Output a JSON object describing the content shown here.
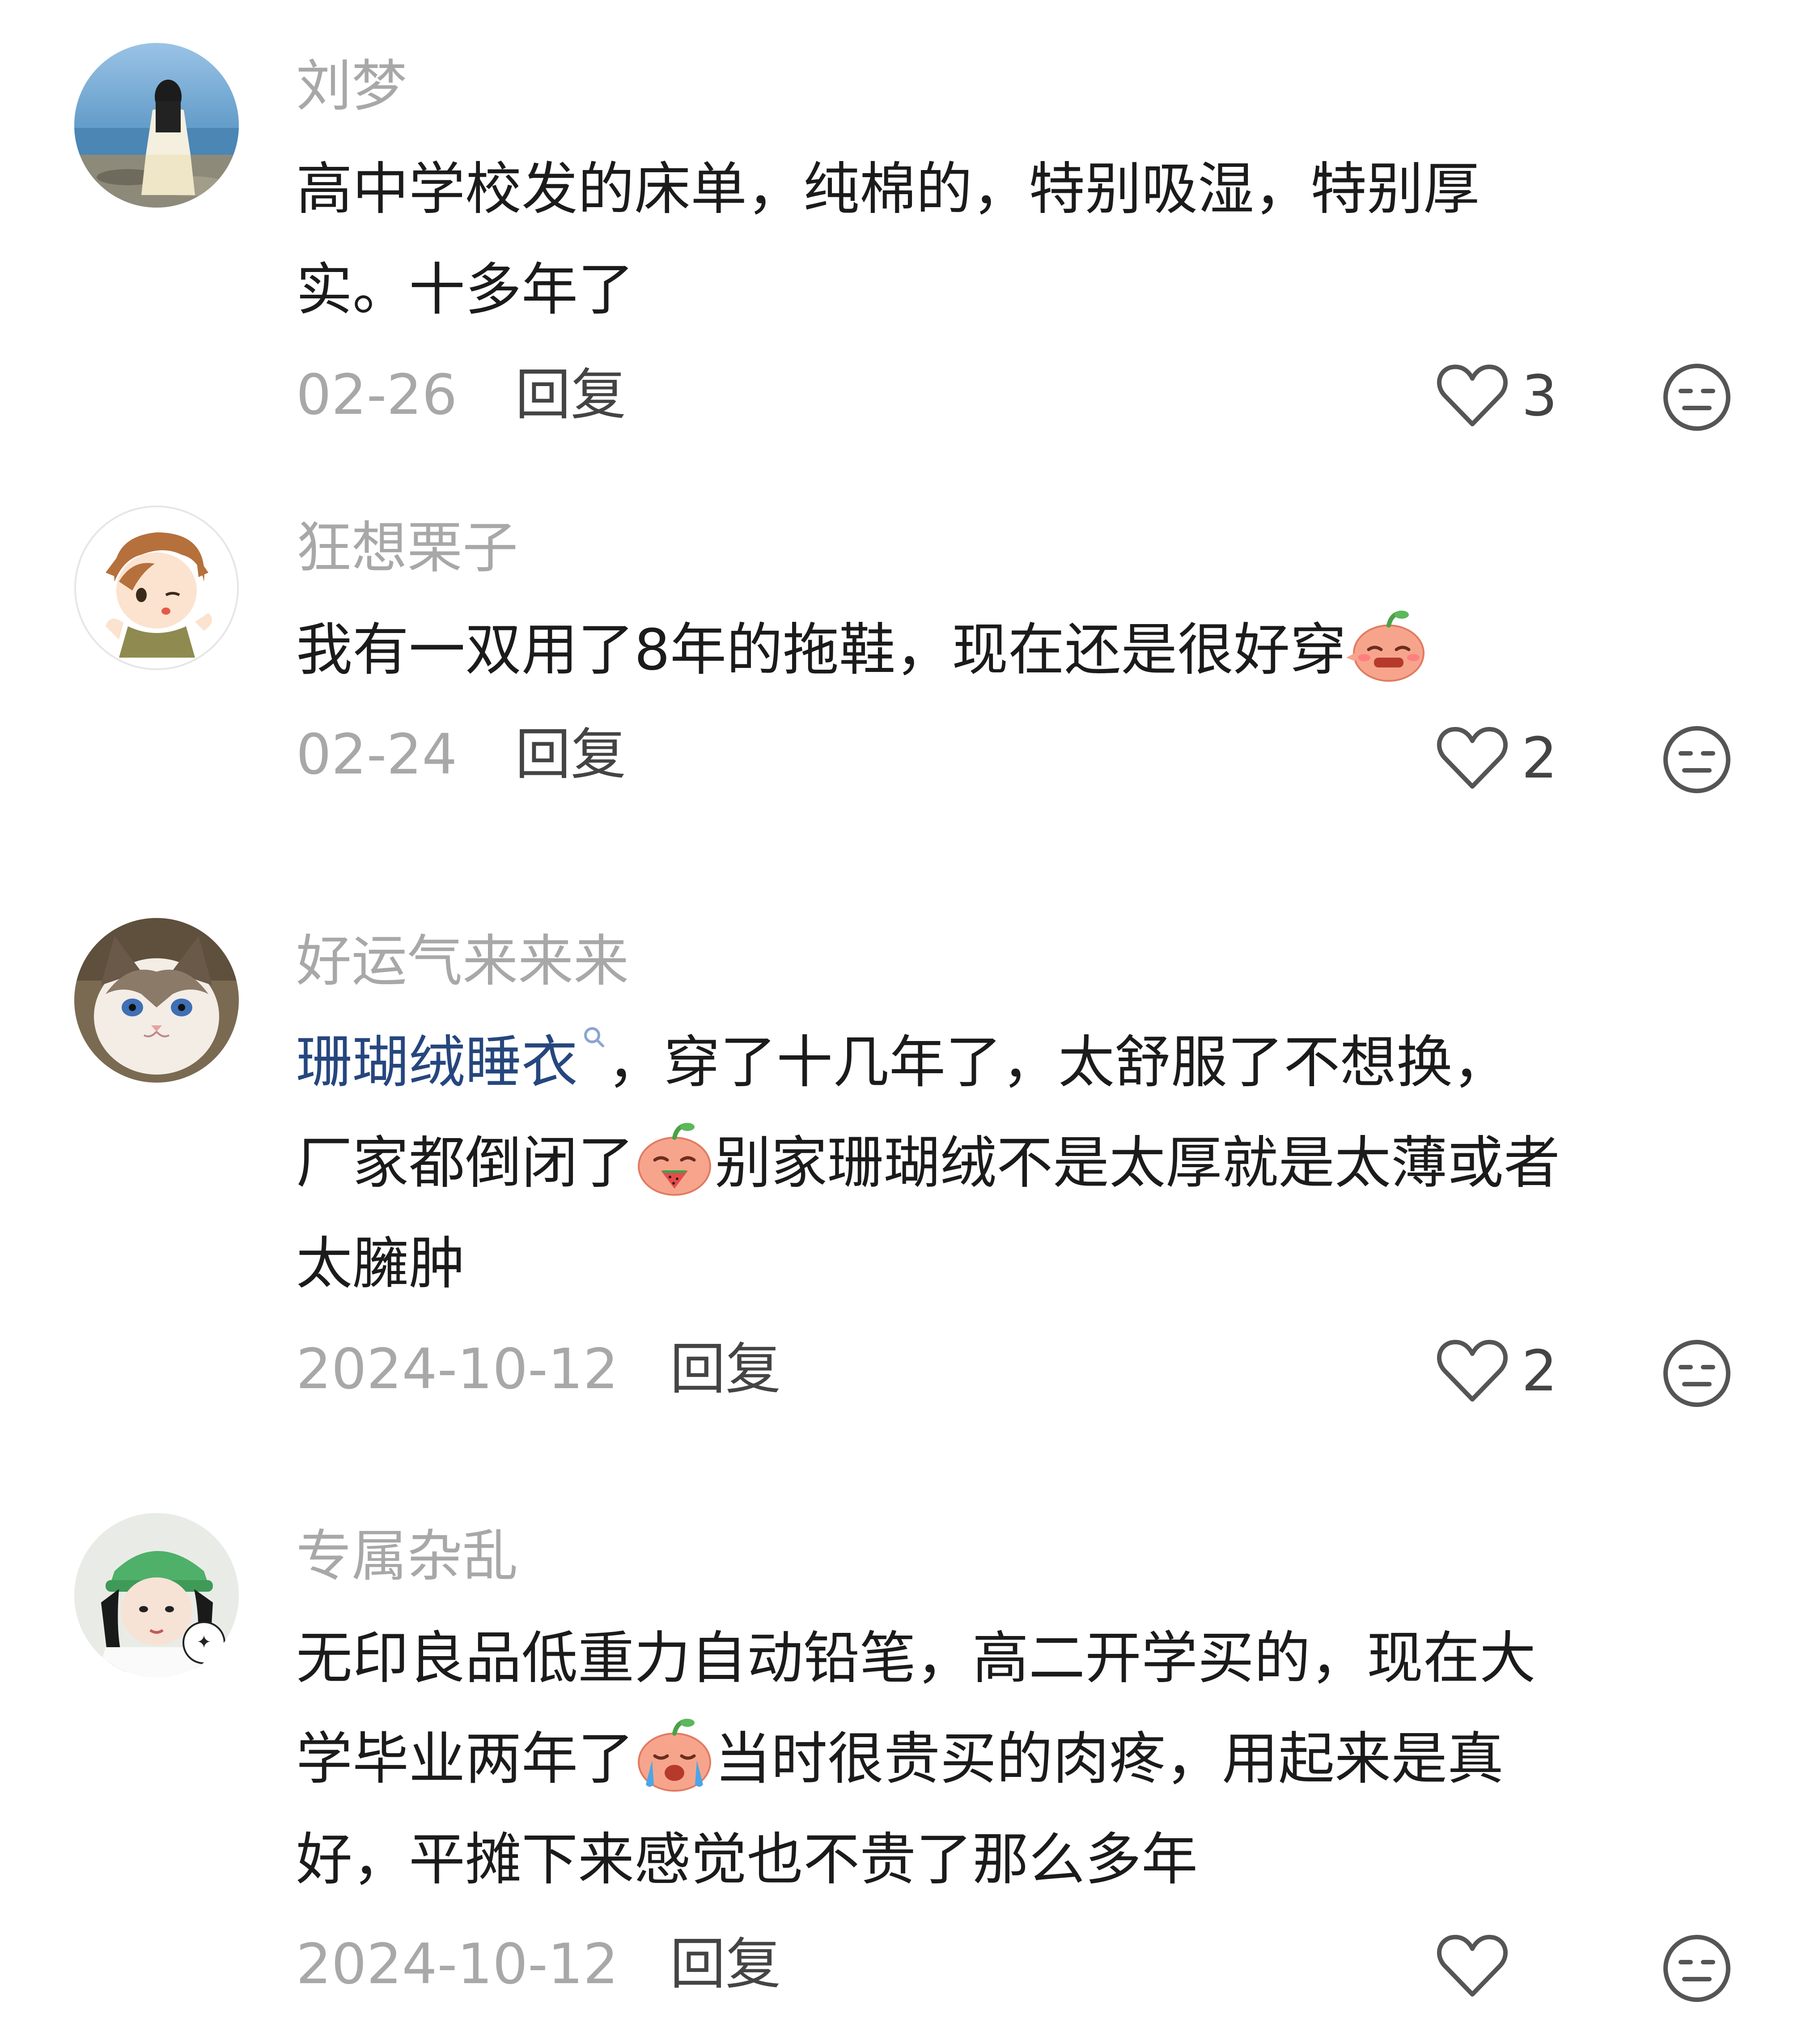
{
  "comments": [
    {
      "username": "刘梦",
      "lines": [
        "高中学校发的床单，纯棉的，特别吸湿，特别厚",
        "实。十多年了"
      ],
      "date": "02-26",
      "reply_label": "回复",
      "likes": "3"
    },
    {
      "username": "狂想栗子",
      "lines": [
        "我有一双用了8年的拖鞋，现在还是很好穿"
      ],
      "date": "02-24",
      "reply_label": "回复",
      "likes": "2"
    },
    {
      "username": "好运气来来来",
      "link_text": "珊瑚绒睡衣",
      "lines": [
        "，穿了十几年了，太舒服了不想换，",
        "厂家都倒闭了",
        "别家珊瑚绒不是太厚就是太薄或者",
        "太臃肿"
      ],
      "date": "2024-10-12",
      "reply_label": "回复",
      "likes": "2"
    },
    {
      "username": "专属杂乱",
      "lines": [
        "无印良品低重力自动铅笔，高二开学买的，现在大",
        "学毕业两年了",
        "当时很贵买的肉疼，用起来是真",
        "好，平摊下来感觉也不贵了那么多年"
      ],
      "date": "2024-10-12",
      "reply_label": "回复",
      "likes": ""
    }
  ],
  "icons": {
    "like": "heart-outline-icon",
    "dislike": "neutral-face-icon",
    "search": "search-icon",
    "emoji": "peach-emoji"
  },
  "colors": {
    "username": "#a8a8a8",
    "text": "#1b1b1b",
    "meta": "#a8a8a8",
    "link": "#26467e"
  }
}
